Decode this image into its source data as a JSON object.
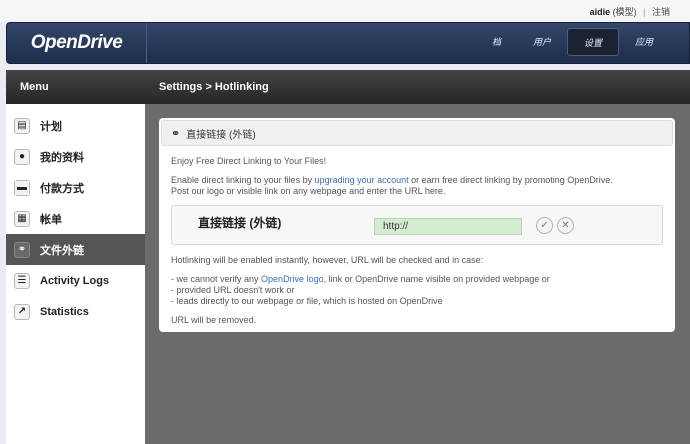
{
  "user_bar": {
    "username": "aidie",
    "user_sub": "(模型)",
    "logout": "注销"
  },
  "header": {
    "logo": "OpenDrive",
    "nav": [
      "档",
      "用户",
      "设置",
      "应用"
    ]
  },
  "sidebar": {
    "title": "Menu",
    "items": [
      {
        "label": "计划",
        "icon": "doc-icon"
      },
      {
        "label": "我的资料",
        "icon": "person-icon"
      },
      {
        "label": "付款方式",
        "icon": "card-icon"
      },
      {
        "label": "帐单",
        "icon": "calculator-icon"
      },
      {
        "label": "文件外链",
        "icon": "link-icon"
      },
      {
        "label": "Activity Logs",
        "icon": "list-icon"
      },
      {
        "label": "Statistics",
        "icon": "chart-icon"
      }
    ]
  },
  "main": {
    "breadcrumb": "Settings > Hotlinking",
    "panel_title": "直接链接 (外链)",
    "intro": "Enjoy Free Direct Linking to Your Files!",
    "desc1_a": "Enable direct linking to your files by ",
    "desc1_link": "upgrading your account",
    "desc1_b": " or earn free direct linking by promoting OpenDrive.",
    "desc2": "Post our logo or visible link on any webpage and enter the URL here.",
    "form_label": "直接链接 (外链)",
    "url_value": "http://",
    "note": "Hotlinking will be enabled instantly, however, URL will be checked and in case:",
    "cond1_a": "- we cannot verify any ",
    "cond1_link": "OpenDrive logo",
    "cond1_b": ", link or OpenDrive name visible on provided webpage or",
    "cond2": "- provided URL doesn't work or",
    "cond3": "- leads directly to our webpage or file, which is hosted on OpenDrive",
    "removed": "URL will be removed."
  }
}
